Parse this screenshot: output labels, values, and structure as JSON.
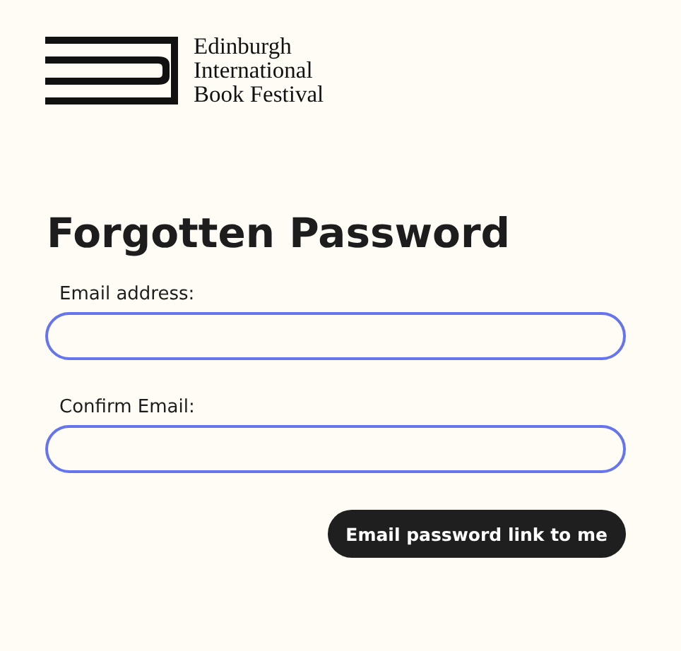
{
  "logo": {
    "lines": [
      "Edinburgh",
      "International",
      "Book Festival"
    ]
  },
  "heading": "Forgotten Password",
  "fields": [
    {
      "label": "Email address:"
    },
    {
      "label": "Confirm Email:"
    }
  ],
  "submit_button": "Email password link to me"
}
